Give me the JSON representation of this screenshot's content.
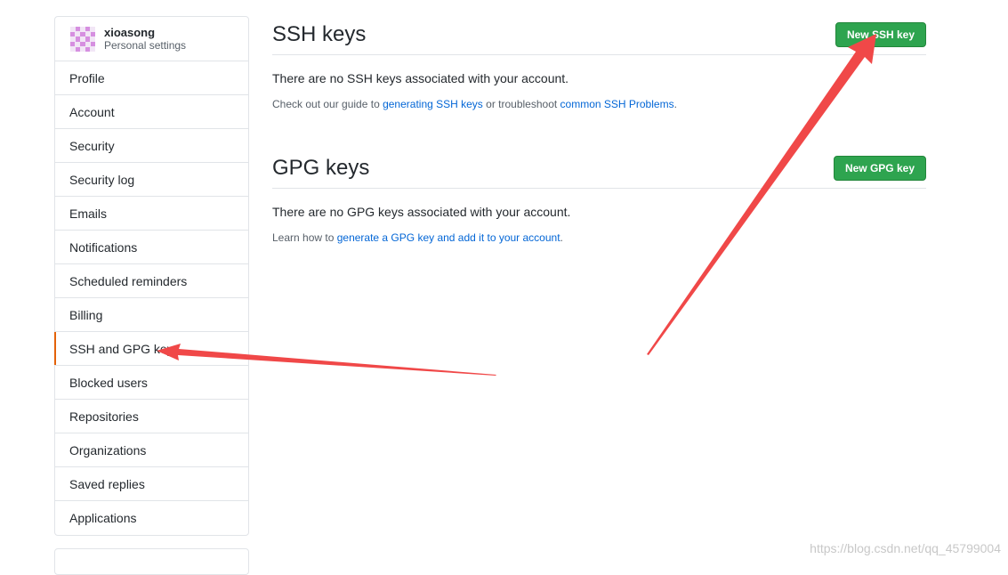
{
  "user": {
    "name": "xioasong",
    "subtitle": "Personal settings"
  },
  "sidebar": {
    "items": [
      {
        "label": "Profile"
      },
      {
        "label": "Account"
      },
      {
        "label": "Security"
      },
      {
        "label": "Security log"
      },
      {
        "label": "Emails"
      },
      {
        "label": "Notifications"
      },
      {
        "label": "Scheduled reminders"
      },
      {
        "label": "Billing"
      },
      {
        "label": "SSH and GPG keys",
        "selected": true
      },
      {
        "label": "Blocked users"
      },
      {
        "label": "Repositories"
      },
      {
        "label": "Organizations"
      },
      {
        "label": "Saved replies"
      },
      {
        "label": "Applications"
      }
    ]
  },
  "ssh": {
    "title": "SSH keys",
    "button": "New SSH key",
    "empty": "There are no SSH keys associated with your account.",
    "help_prefix": "Check out our guide to ",
    "help_link1": "generating SSH keys",
    "help_middle": " or troubleshoot ",
    "help_link2": "common SSH Problems",
    "help_suffix": "."
  },
  "gpg": {
    "title": "GPG keys",
    "button": "New GPG key",
    "empty": "There are no GPG keys associated with your account.",
    "help_prefix": "Learn how to ",
    "help_link": "generate a GPG key and add it to your account",
    "help_suffix": "."
  },
  "watermark": "https://blog.csdn.net/qq_45799004",
  "colors": {
    "accent_green": "#2ea44f",
    "link_blue": "#0366d6",
    "selected_marker": "#e36209",
    "annotation_arrow": "#f04848"
  }
}
